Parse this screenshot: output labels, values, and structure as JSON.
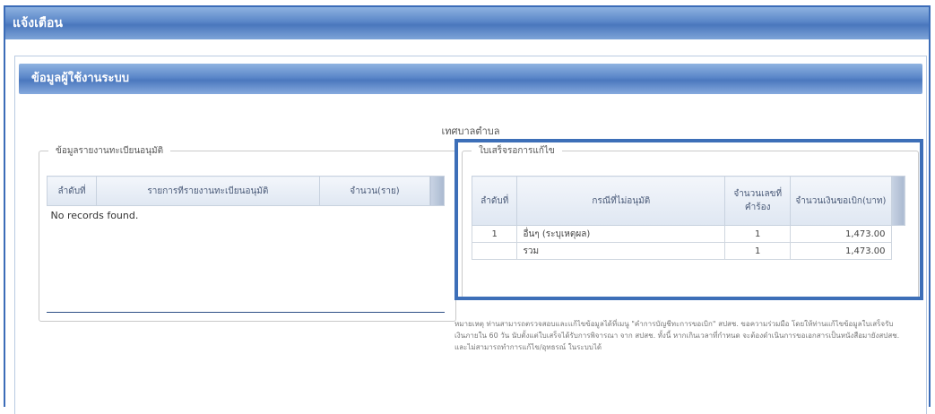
{
  "window": {
    "title": "แจ้งเตือน"
  },
  "panel": {
    "title": "ข้อมูลผู้ใช้งานระบบ"
  },
  "organization": {
    "name": "เทศบาลตำบล"
  },
  "left_section": {
    "legend": "ข้อมูลรายงานทะเบียนอนุมัติ",
    "columns": [
      "ลำดับที่",
      "รายการทีรายงานทะเบียนอนุมัติ",
      "จำนวน(ราย)"
    ],
    "empty_message": "No records found."
  },
  "right_section": {
    "legend": "ใบเสร็จรอการแก้ไข",
    "columns": [
      "ลำดับที่",
      "กรณีที่ไม่อนุมัติ",
      "จำนวนเลขที่คำร้อง",
      "จำนวนเงินขอเบิก(บาท)"
    ],
    "rows": [
      {
        "no": "1",
        "case": "อื่นๆ (ระบุเหตุผล)",
        "count": "1",
        "amount": "1,473.00"
      },
      {
        "no": "",
        "case": "รวม",
        "count": "1",
        "amount": "1,473.00"
      }
    ]
  },
  "note": {
    "text": "หมายเหตุ ท่านสามารถตรวจสอบและแก้ไขข้อมูลได้ที่เมนู \"คำการบัญชีทะการขอเบิก\" สปสช. ขอความร่วมมือ โดยให้ท่านแก้ไขข้อมูลใบเสร็จรับเงินภายใน 60 วัน นับตั้งแต่ใบเสร็จได้รับการพิจารณา จาก สปสช. ทั้งนี้ หากเกินเวลาที่กำหนด จะต้องดำเนินการขอเอกสารเป็นหนังสือมายังสปสช. และไม่สามารถทำการแก้ไข/อุทธรณ์ ในระบบได้"
  }
}
